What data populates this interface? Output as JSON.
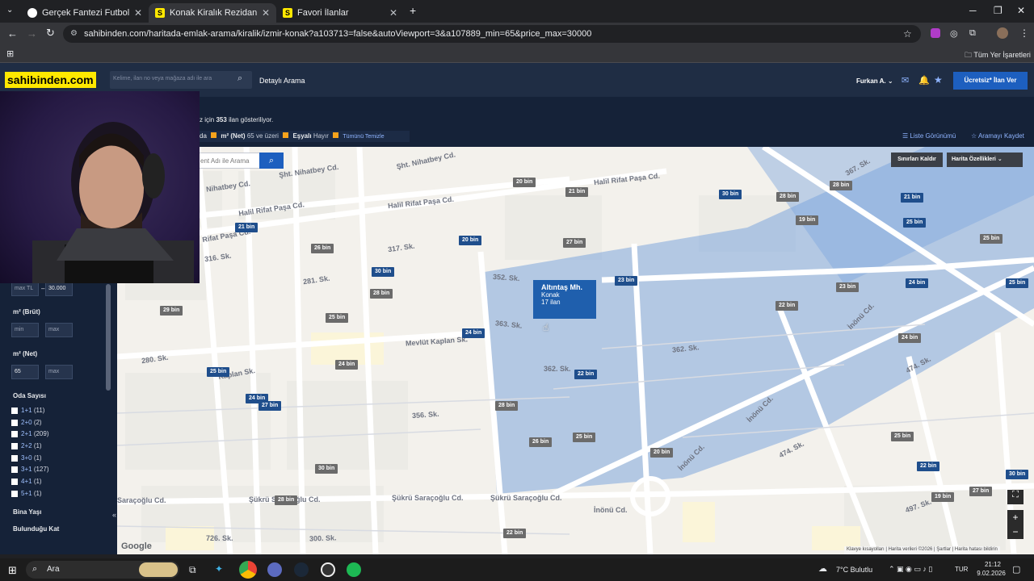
{
  "tabs": [
    {
      "label": "Gerçek Fantezi Futbol - Sorare",
      "favicon": "sorare-icon",
      "color": "#ffffff"
    },
    {
      "label": "Konak Kiralık Rezidans, Villa, M",
      "favicon": "S",
      "color": "#ffe800"
    },
    {
      "label": "Favori İlanlar",
      "favicon": "S",
      "color": "#ffe800"
    }
  ],
  "new_tab": "+",
  "url": "sahibinden.com/haritada-emlak-arama/kiralik/izmir-konak?a103713=false&autoViewport=3&a107889_min=65&price_max=30000",
  "bookmarks_label": "Tüm Yer İşaretleri",
  "site": {
    "logo": "sahibinden.com",
    "search_placeholder": "Kelime, ilan no veya mağaza adı ile ara",
    "detailed_search": "Detaylı Arama",
    "user": "Furkan A.",
    "post_ad": "Ücretsiz* İlan Ver"
  },
  "results": {
    "prefix": "z için",
    "count": "353",
    "suffix": "ilan gösteriliyor."
  },
  "filters": [
    {
      "label": "da",
      "value": ""
    },
    {
      "label": "m² (Net)",
      "value": "65 ve üzeri"
    },
    {
      "label": "Eşyalı",
      "value": "Hayır"
    }
  ],
  "clear_all": "Tümünü Temizle",
  "list_view": "Liste Görünümü",
  "save_search": "Aramayı Kaydet",
  "map_search_placeholder": "ent  Adı ile Arama",
  "map_buttons": {
    "remove_bounds": "Sınırları Kaldır",
    "map_features": "Harita Özellikleri"
  },
  "sidebar": {
    "price_min": "max TL",
    "price_max": "30.000",
    "m2_brut_label": "m² (Brüt)",
    "m2_brut_min": "min",
    "m2_brut_max": "max",
    "m2_net_label": "m² (Net)",
    "m2_net_min": "65",
    "m2_net_max": "max",
    "rooms_label": "Oda Sayısı",
    "rooms": [
      {
        "label": "1+1",
        "count": "(11)"
      },
      {
        "label": "2+0",
        "count": "(2)"
      },
      {
        "label": "2+1",
        "count": "(209)"
      },
      {
        "label": "2+2",
        "count": "(1)"
      },
      {
        "label": "3+0",
        "count": "(1)"
      },
      {
        "label": "3+1",
        "count": "(127)"
      },
      {
        "label": "4+1",
        "count": "(1)"
      },
      {
        "label": "5+1",
        "count": "(1)"
      }
    ],
    "building_age": "Bina Yaşı",
    "floor": "Bulunduğu Kat"
  },
  "popup": {
    "title": "Altıntaş Mh.",
    "district": "Konak",
    "count": "17 ilan"
  },
  "pins": [
    {
      "text": "20 bin",
      "type": "gray"
    },
    {
      "text": "21 bin",
      "type": "gray"
    },
    {
      "text": "28 bin",
      "type": "gray"
    },
    {
      "text": "21 bin",
      "type": "blue"
    },
    {
      "text": "26 bin",
      "type": "gray"
    },
    {
      "text": "20 bin",
      "type": "blue"
    },
    {
      "text": "27 bin",
      "type": "gray"
    },
    {
      "text": "30 bin",
      "type": "blue"
    },
    {
      "text": "30 bin",
      "type": "blue"
    },
    {
      "text": "28 bin",
      "type": "gray"
    },
    {
      "text": "21 bin",
      "type": "blue"
    },
    {
      "text": "19 bin",
      "type": "gray"
    },
    {
      "text": "25 bin",
      "type": "blue"
    },
    {
      "text": "25 bin",
      "type": "gray"
    },
    {
      "text": "23 bin",
      "type": "blue"
    },
    {
      "text": "24 bin",
      "type": "blue"
    },
    {
      "text": "23 bin",
      "type": "gray"
    },
    {
      "text": "25 bin",
      "type": "blue"
    },
    {
      "text": "28 bin",
      "type": "gray"
    },
    {
      "text": "29 bin",
      "type": "gray"
    },
    {
      "text": "25 bin",
      "type": "gray"
    },
    {
      "text": "24 bin",
      "type": "blue"
    },
    {
      "text": "22 bin",
      "type": "gray"
    },
    {
      "text": "24 bin",
      "type": "gray"
    },
    {
      "text": "25 bin",
      "type": "blue"
    },
    {
      "text": "24 bin",
      "type": "gray"
    },
    {
      "text": "22 bin",
      "type": "blue"
    },
    {
      "text": "24 bin",
      "type": "blue"
    },
    {
      "text": "27 bin",
      "type": "blue"
    },
    {
      "text": "28 bin",
      "type": "gray"
    },
    {
      "text": "26 bin",
      "type": "gray"
    },
    {
      "text": "25 bin",
      "type": "gray"
    },
    {
      "text": "20 bin",
      "type": "gray"
    },
    {
      "text": "25 bin",
      "type": "gray"
    },
    {
      "text": "22 bin",
      "type": "blue"
    },
    {
      "text": "30 bin",
      "type": "blue"
    },
    {
      "text": "30 bin",
      "type": "gray"
    },
    {
      "text": "28 bin",
      "type": "gray"
    },
    {
      "text": "19 bin",
      "type": "gray"
    },
    {
      "text": "27 bin",
      "type": "gray"
    },
    {
      "text": "22 bin",
      "type": "gray"
    }
  ],
  "streets": [
    "Şht. Nihatbey Cd.",
    "Şht. Nihatbey Cd.",
    "Nihatbey Cd.",
    "Halil Rifat Paşa Cd.",
    "Halil Rifat Paşa Cd.",
    "Halil Rifat Paşa Cd.",
    "Rifat Paşa Cd.",
    "316. Sk.",
    "317. Sk.",
    "352. Sk.",
    "Mevlüt Kaplan Sk.",
    "Kaplan Sk.",
    "362. Sk.",
    "362. Sk.",
    "356. Sk.",
    "İnönü Cd.",
    "İnönü Cd.",
    "İnönü Cd.",
    "İnönü Cd.",
    "Şükrü Saraçoğlu Cd.",
    "Şükrü Saraçoğlu Cd.",
    "Şükrü Saraçoğlu Cd.",
    "Saraçoğlu Cd.",
    "300. Sk.",
    "726. Sk.",
    "474. Sk.",
    "474. Sk.",
    "497. Sk.",
    "367. Sk.",
    "281. Sk.",
    "280. Sk.",
    "363. Sk."
  ],
  "map_footer": [
    "Klavye kısayolları",
    "Harita verileri ©2026",
    "Şartlar",
    "Harita hatası bildirin"
  ],
  "google": "Google",
  "taskbar": {
    "search": "Ara",
    "weather": "7°C  Bulutlu",
    "lang": "TUR",
    "time": "21:12",
    "date": "9.02.2026"
  }
}
